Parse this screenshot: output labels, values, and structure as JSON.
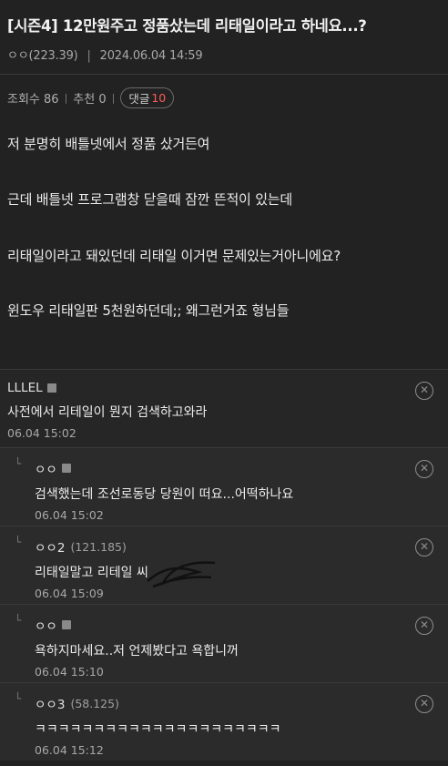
{
  "post": {
    "title": "[시즌4] 12만원주고 정품샀는데 리태일이라고 하네요...?",
    "author": "ㅇㅇ(223.39)",
    "date": "2024.06.04 14:59",
    "views_label": "조회수 86",
    "recommend_label": "추천 0",
    "comments_label": "댓글",
    "comments_count": "10",
    "body": [
      "저 분명히 배틀넷에서 정품 샀거든여",
      "근데 배틀넷 프로그램창 닫을때 잠깐 뜬적이 있는데",
      "리태일이라고 돼있던데 리태일 이거면 문제있는거아니에요?",
      "윈도우 리태일판 5천원하던데;; 왜그런거죠 형님들"
    ]
  },
  "comments": [
    {
      "author": "LLLEL",
      "ip": "",
      "text": "사전에서 리테일이 뭔지 검색하고와라",
      "time": "06.04 15:02",
      "reply": false
    },
    {
      "author": "ㅇㅇ",
      "ip": "",
      "text": "검색했는데 조선로동당 당원이 떠요...어떡하나요",
      "time": "06.04 15:02",
      "reply": true
    },
    {
      "author": "ㅇㅇ2",
      "ip": "(121.185)",
      "text": "리태일말고 리테일 씨",
      "time": "06.04 15:09",
      "reply": true
    },
    {
      "author": "ㅇㅇ",
      "ip": "",
      "text": "욕하지마세요..저 언제봤다고 욕합니꺼",
      "time": "06.04 15:10",
      "reply": true
    },
    {
      "author": "ㅇㅇ3",
      "ip": "(58.125)",
      "text": "ㅋㅋㅋㅋㅋㅋㅋㅋㅋㅋㅋㅋㅋㅋㅋㅋㅋㅋㅋㅋㅋ",
      "time": "06.04 15:12",
      "reply": true
    }
  ],
  "icons": {
    "delete": "close-circle-icon",
    "reply": "reply-arrow-icon",
    "user": "user-badge-icon"
  }
}
